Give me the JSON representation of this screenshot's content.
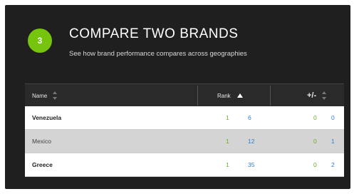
{
  "header": {
    "step_number": "3",
    "title": "COMPARE TWO BRANDS",
    "subtitle": "See how brand performance compares across geographies"
  },
  "table": {
    "columns": {
      "name": "Name",
      "rank": "Rank",
      "plus_minus": "+/-"
    },
    "rows": [
      {
        "name": "Venezuela",
        "rank_a": "1",
        "rank_b": "6",
        "pm_a": "0",
        "pm_b": "0"
      },
      {
        "name": "Mexico",
        "rank_a": "1",
        "rank_b": "12",
        "pm_a": "0",
        "pm_b": "1"
      },
      {
        "name": "Greece",
        "rank_a": "1",
        "rank_b": "35",
        "pm_a": "0",
        "pm_b": "2"
      }
    ]
  },
  "colors": {
    "accent_green": "#76c40e",
    "value_green": "#6ab023",
    "value_blue": "#2a7fd6",
    "panel_background": "#1f1f1f"
  },
  "icons": {
    "name_sort": "sort-icon",
    "rank_sort": "sort-ascending-icon",
    "plus_minus_sort": "sort-icon"
  }
}
